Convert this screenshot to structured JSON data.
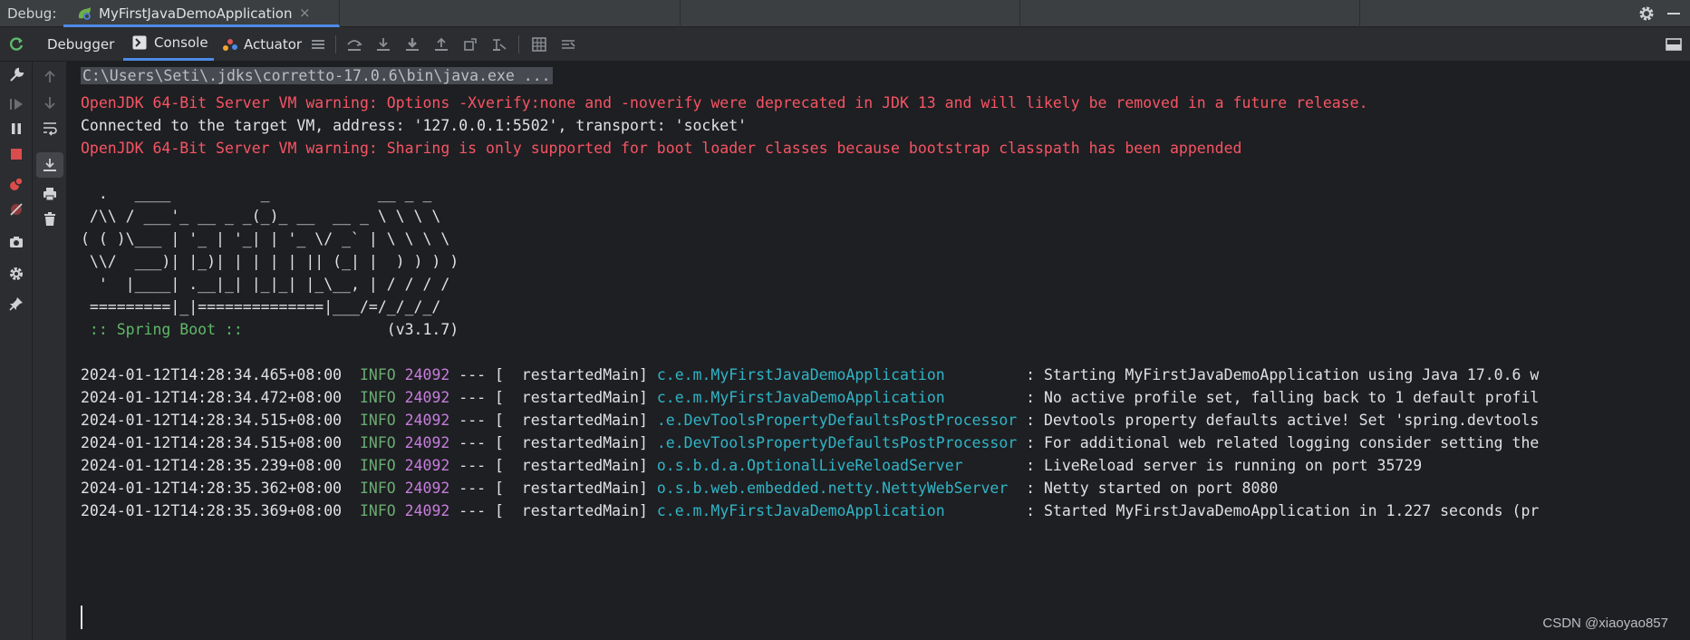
{
  "tabbar": {
    "label": "Debug:",
    "tab_title": "MyFirstJavaDemoApplication",
    "tab_close": "×"
  },
  "toolbar": {
    "debugger_label": "Debugger",
    "console_label": "Console",
    "actuator_label": "Actuator"
  },
  "console": {
    "command_line": "C:\\Users\\Seti\\.jdks\\corretto-17.0.6\\bin\\java.exe ...",
    "warning_1": "OpenJDK 64-Bit Server VM warning: Options -Xverify:none and -noverify were deprecated in JDK 13 and will likely be removed in a future release.",
    "connected": "Connected to the target VM, address: '127.0.0.1:5502', transport: 'socket'",
    "warning_2": "OpenJDK 64-Bit Server VM warning: Sharing is only supported for boot loader classes because bootstrap classpath has been appended",
    "banner": [
      "  .   ____          _            __ _ _",
      " /\\\\ / ___'_ __ _ _(_)_ __  __ _ \\ \\ \\ \\",
      "( ( )\\___ | '_ | '_| | '_ \\/ _` | \\ \\ \\ \\",
      " \\\\/  ___)| |_)| | | | | || (_| |  ) ) ) )",
      "  '  |____| .__|_| |_|_| |_\\__, | / / / /",
      " =========|_|==============|___/=/_/_/_/"
    ],
    "spring_boot_label": " :: Spring Boot :: ",
    "spring_boot_version": "               (v3.1.7)",
    "logs": [
      {
        "ts": "2024-01-12T14:28:34.465+08:00",
        "level": "INFO",
        "pid": "24092",
        "thread": "--- [  restartedMain]",
        "logger": "c.e.m.MyFirstJavaDemoApplication        ",
        "msg": " : Starting MyFirstJavaDemoApplication using Java 17.0.6 w"
      },
      {
        "ts": "2024-01-12T14:28:34.472+08:00",
        "level": "INFO",
        "pid": "24092",
        "thread": "--- [  restartedMain]",
        "logger": "c.e.m.MyFirstJavaDemoApplication        ",
        "msg": " : No active profile set, falling back to 1 default profil"
      },
      {
        "ts": "2024-01-12T14:28:34.515+08:00",
        "level": "INFO",
        "pid": "24092",
        "thread": "--- [  restartedMain]",
        "logger": ".e.DevToolsPropertyDefaultsPostProcessor",
        "msg": " : Devtools property defaults active! Set 'spring.devtools"
      },
      {
        "ts": "2024-01-12T14:28:34.515+08:00",
        "level": "INFO",
        "pid": "24092",
        "thread": "--- [  restartedMain]",
        "logger": ".e.DevToolsPropertyDefaultsPostProcessor",
        "msg": " : For additional web related logging consider setting the"
      },
      {
        "ts": "2024-01-12T14:28:35.239+08:00",
        "level": "INFO",
        "pid": "24092",
        "thread": "--- [  restartedMain]",
        "logger": "o.s.b.d.a.OptionalLiveReloadServer      ",
        "msg": " : LiveReload server is running on port 35729"
      },
      {
        "ts": "2024-01-12T14:28:35.362+08:00",
        "level": "INFO",
        "pid": "24092",
        "thread": "--- [  restartedMain]",
        "logger": "o.s.b.web.embedded.netty.NettyWebServer ",
        "msg": " : Netty started on port 8080"
      },
      {
        "ts": "2024-01-12T14:28:35.369+08:00",
        "level": "INFO",
        "pid": "24092",
        "thread": "--- [  restartedMain]",
        "logger": "c.e.m.MyFirstJavaDemoApplication        ",
        "msg": " : Started MyFirstJavaDemoApplication in 1.227 seconds (pr"
      }
    ]
  },
  "watermark": "CSDN @xiaoyao857",
  "colors": {
    "accent": "#4d8ae6",
    "warning": "#f75464",
    "info": "#6aab73",
    "pid": "#c77dde",
    "logger": "#2fb5c7",
    "spring": "#5fb96a"
  }
}
